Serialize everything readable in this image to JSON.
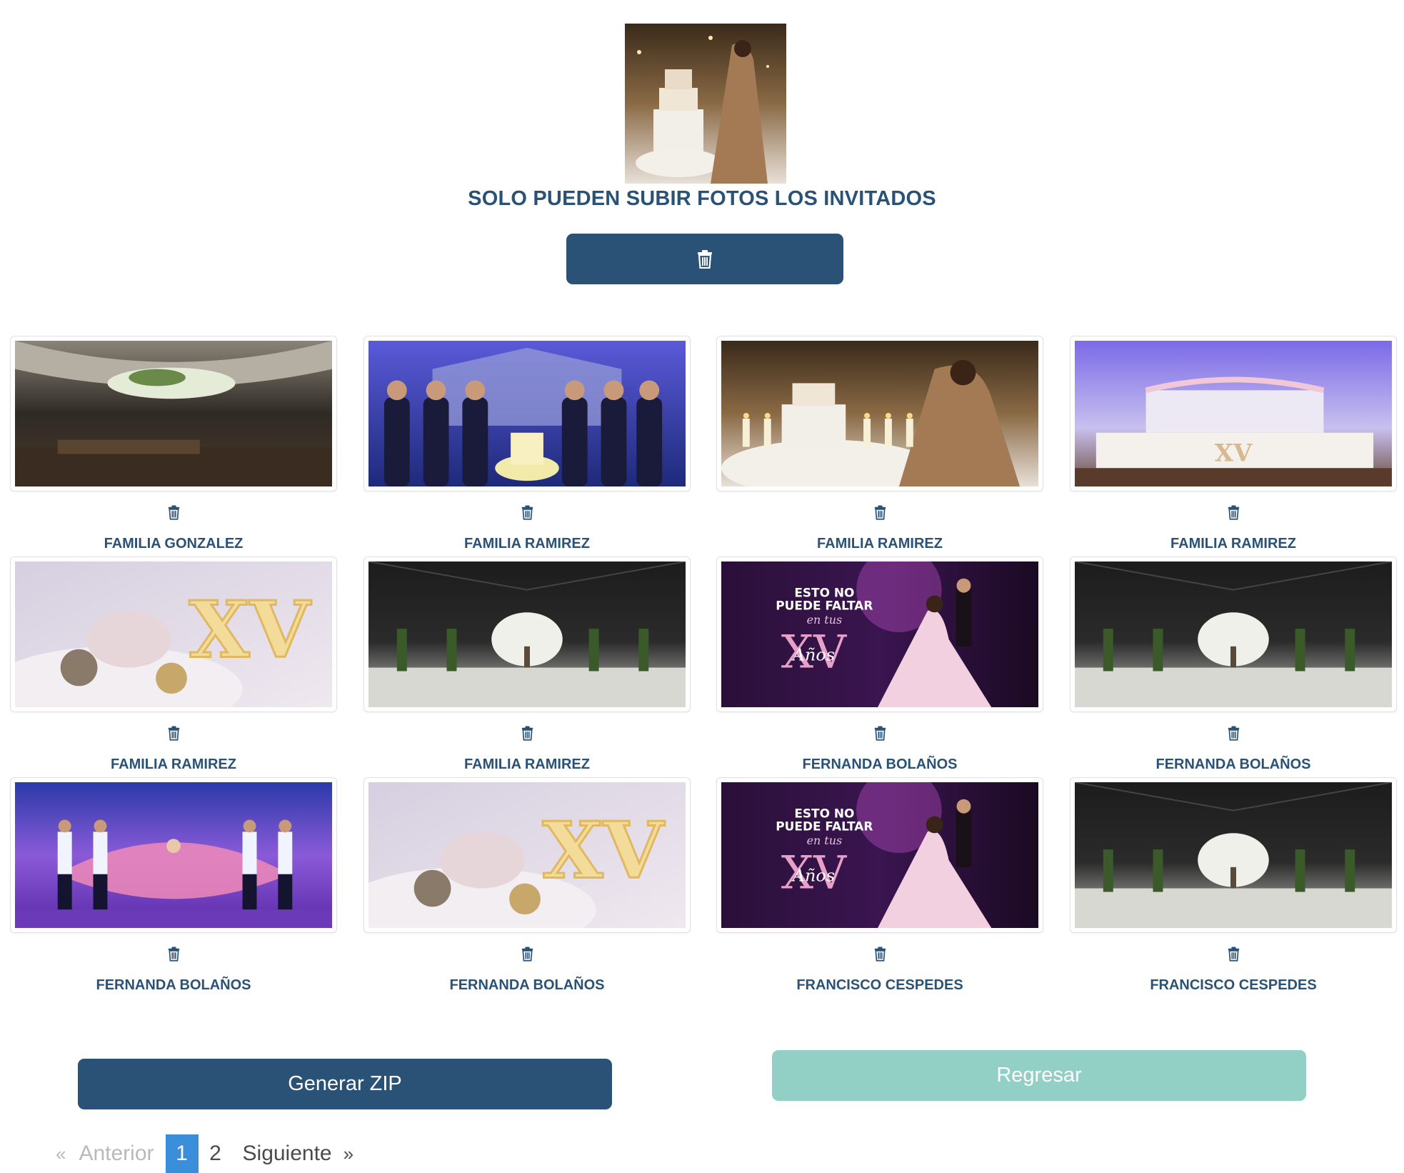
{
  "header": {
    "title": "SOLO PUEDEN SUBIR FOTOS LOS INVITADOS",
    "hero_image": "quinceañera-cake-photo",
    "delete_all_icon": "trash-icon"
  },
  "photos": [
    {
      "author": "FAMILIA GONZALEZ",
      "scene": "tented-hall"
    },
    {
      "author": "FAMILIA RAMIREZ",
      "scene": "family-cake-blue"
    },
    {
      "author": "FAMILIA RAMIREZ",
      "scene": "cake-gold"
    },
    {
      "author": "FAMILIA RAMIREZ",
      "scene": "purple-table-xv"
    },
    {
      "author": "FAMILIA RAMIREZ",
      "scene": "xv-lights"
    },
    {
      "author": "FAMILIA RAMIREZ",
      "scene": "dark-tent-tree"
    },
    {
      "author": "FERNANDA BOLAÑOS",
      "scene": "dance-poster"
    },
    {
      "author": "FERNANDA BOLAÑOS",
      "scene": "dark-tent-tree"
    },
    {
      "author": "FERNANDA BOLAÑOS",
      "scene": "stage-dance"
    },
    {
      "author": "FERNANDA BOLAÑOS",
      "scene": "xv-lights"
    },
    {
      "author": "FRANCISCO CESPEDES",
      "scene": "dance-poster"
    },
    {
      "author": "FRANCISCO CESPEDES",
      "scene": "dark-tent-tree"
    }
  ],
  "poster_text": {
    "line1": "ESTO NO",
    "line2": "PUEDE FALTAR",
    "line3": "en tus",
    "big": "XV",
    "script": "Años"
  },
  "xv_text": "XV",
  "actions": {
    "zip_label": "Generar ZIP",
    "back_label": "Regresar"
  },
  "pagination": {
    "prev_arrow": "«",
    "prev_label": "Anterior",
    "pages": [
      "1",
      "2"
    ],
    "current": "1",
    "next_label": "Siguiente",
    "next_arrow": "»"
  },
  "colors": {
    "primary": "#2a5276",
    "secondary": "#92cfc5",
    "page_active": "#3b8ed9"
  }
}
